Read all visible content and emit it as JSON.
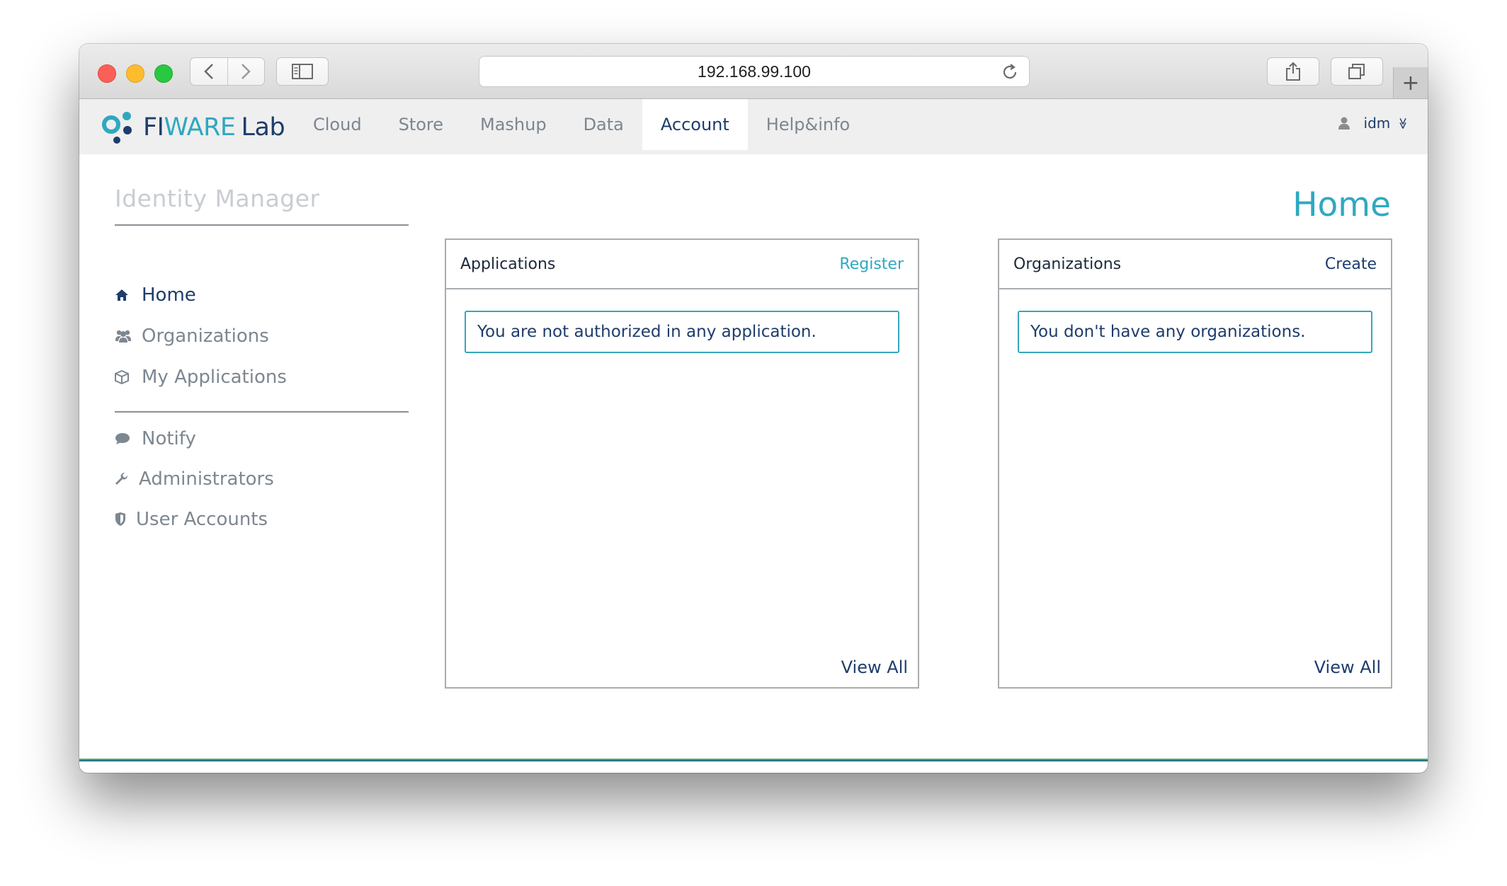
{
  "browser": {
    "url": "192.168.99.100"
  },
  "header": {
    "logo": {
      "fi": "FI",
      "ware": "WARE",
      "lab": "Lab"
    },
    "nav": [
      {
        "label": "Cloud"
      },
      {
        "label": "Store"
      },
      {
        "label": "Mashup"
      },
      {
        "label": "Data"
      },
      {
        "label": "Account",
        "active": true
      },
      {
        "label": "Help&info"
      }
    ],
    "user": {
      "name": "idm",
      "caret": "≫"
    }
  },
  "sidebar": {
    "title": "Identity Manager",
    "primary": [
      {
        "label": "Home",
        "icon": "home-icon",
        "active": true
      },
      {
        "label": "Organizations",
        "icon": "users-icon"
      },
      {
        "label": "My Applications",
        "icon": "cube-icon"
      }
    ],
    "secondary": [
      {
        "label": "Notify",
        "icon": "comment-icon"
      },
      {
        "label": "Administrators",
        "icon": "wrench-icon"
      },
      {
        "label": "User Accounts",
        "icon": "shield-icon"
      }
    ]
  },
  "main": {
    "heading": "Home",
    "applications": {
      "title": "Applications",
      "action": "Register",
      "empty_message": "You are not authorized in any application.",
      "view_all": "View All"
    },
    "organizations": {
      "title": "Organizations",
      "action": "Create",
      "empty_message": "You don't have any organizations.",
      "view_all": "View All"
    }
  },
  "colors": {
    "accent": "#2fa8c0",
    "primary": "#1e3d6b",
    "muted": "#7d8790"
  }
}
